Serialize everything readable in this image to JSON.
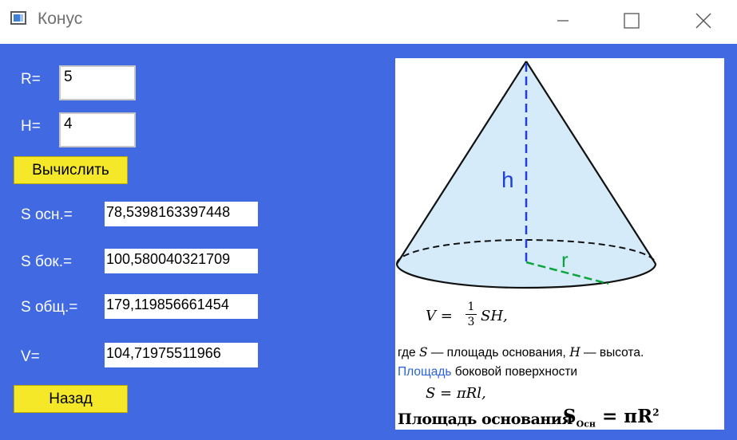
{
  "window": {
    "title": "Конус",
    "minimize_icon": "minimize-icon",
    "maximize_icon": "maximize-icon",
    "close_icon": "close-icon"
  },
  "inputs": {
    "r_label": "R=",
    "r_value": "5",
    "h_label": "H=",
    "h_value": "4"
  },
  "calculate_button": "Вычислить",
  "results": [
    {
      "label": "S осн.=",
      "value": "78,5398163397448"
    },
    {
      "label": "S бок.=",
      "value": "100,580040321709"
    },
    {
      "label": "S общ.=",
      "value": "179,119856661454"
    },
    {
      "label": "V=",
      "value": "104,71975511966"
    }
  ],
  "back_button": "Назад",
  "picture": {
    "height_label": "h",
    "radius_label": "r",
    "volume_formula_lhs": "V =",
    "volume_formula_num": "1",
    "volume_formula_den": "3",
    "volume_formula_rhs": "SH,",
    "where_text_1": "где",
    "where_S": "S",
    "where_text_2": "— площадь основания,",
    "where_H": "H",
    "where_text_3": "— высота.",
    "lateral_link": "Площадь",
    "lateral_text": "боковой поверхности",
    "lateral_formula": "S = πRl,",
    "base_text": "Площадь основания",
    "base_formula_s": "S",
    "base_formula_sub": "Осн",
    "base_formula_rhs": "= πR",
    "base_formula_sup": "2"
  },
  "colors": {
    "client_bg": "#4169e1",
    "button_bg": "#f5e829",
    "cone_fill": "#d6ebfa",
    "height_line": "#1f3fd6",
    "radius_line": "#0aa53c",
    "link": "#2b62d9"
  }
}
